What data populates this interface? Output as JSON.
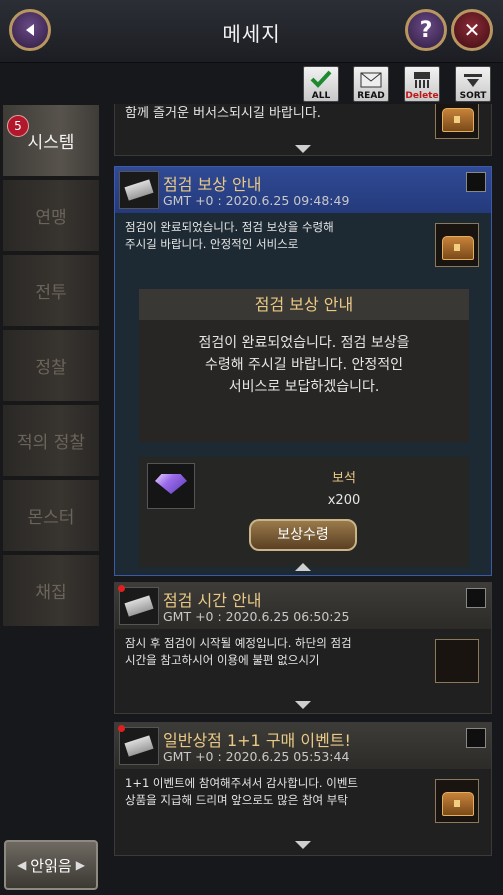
{
  "header": {
    "title": "메세지",
    "back_icon": "back-arrow-icon",
    "help_label": "?",
    "close_label": "✕"
  },
  "toolbar": {
    "all_label": "ALL",
    "read_label": "READ",
    "delete_label": "Delete",
    "sort_label": "SORT"
  },
  "sidebar": {
    "badge": "5",
    "tabs": [
      {
        "label": "시스템"
      },
      {
        "label": "연맹"
      },
      {
        "label": "전투"
      },
      {
        "label": "정찰"
      },
      {
        "label": "적의 정찰"
      },
      {
        "label": "몬스터"
      },
      {
        "label": "채집"
      }
    ]
  },
  "unread_button": {
    "label": "안읽음",
    "left_arrow": "◀",
    "right_arrow": "▶"
  },
  "messages": [
    {
      "body": "함께 즐거운 버서스되시길 바랍니다."
    },
    {
      "title": "점검 보상 안내",
      "date": "GMT +0 : 2020.6.25 09:48:49",
      "body_line1": "점검이 완료되었습니다. 점검 보상을 수령해",
      "body_line2": "주시길 바랍니다. 안정적인 서비스로",
      "detail_title": "점검 보상 안내",
      "detail_line1": "점검이 완료되었습니다. 점검 보상을",
      "detail_line2": "수령해 주시길 바랍니다. 안정적인",
      "detail_line3": "서비스로 보답하겠습니다.",
      "reward_name": "보석",
      "reward_qty": "x200",
      "claim_label": "보상수령"
    },
    {
      "title": "점검 시간 안내",
      "date": "GMT +0 : 2020.6.25 06:50:25",
      "body_line1": "잠시 후 점검이 시작될 예정입니다. 하단의 점검",
      "body_line2": "시간을 참고하시어 이용에 불편 없으시기"
    },
    {
      "title": "일반상점 1+1 구매 이벤트!",
      "date": "GMT +0 : 2020.6.25 05:53:44",
      "body_line1": "1+1 이벤트에 참여해주셔서 감사합니다. 이벤트",
      "body_line2": "상품을 지급해 드리며 앞으로도 많은 참여 부탁"
    }
  ]
}
